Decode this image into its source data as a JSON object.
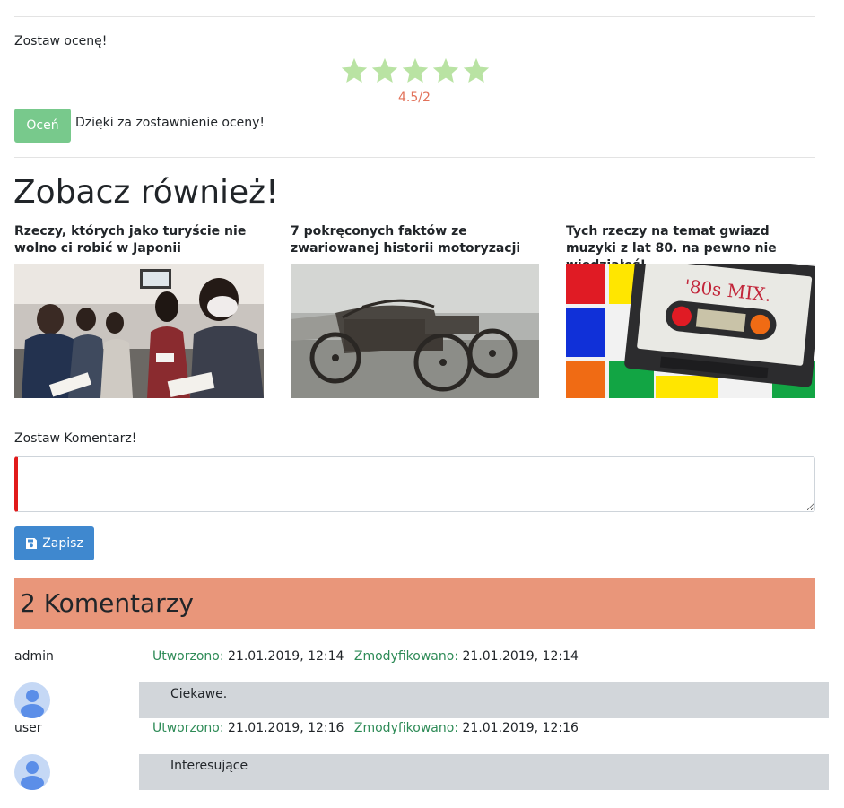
{
  "rating": {
    "label": "Zostaw ocenę!",
    "value": "4.5/2",
    "stars_total": 5,
    "star_color": "#b9e3a3",
    "button_label": "Oceń",
    "thanks": "Dzięki za zostawnienie oceny!"
  },
  "see_also": {
    "title": "Zobacz również!",
    "articles": [
      {
        "title": "Rzeczy, których jako turyście nie wolno ci robić w Japonii",
        "image": "people-seated-photo"
      },
      {
        "title": "7 pokręconych faktów ze zwariowanej historii motoryzacji",
        "image": "vintage-car-photo"
      },
      {
        "title": "Tych rzeczy na temat gwiazd muzyki z lat 80. na pewno nie wiedziałeś!",
        "image": "cassette-tape-photo",
        "cassette_label": "'80s MIX."
      }
    ]
  },
  "comment_form": {
    "label": "Zostaw Komentarz!",
    "textarea_value": "",
    "save_label": "Zapisz",
    "save_icon": "floppy-disk-icon"
  },
  "comments": {
    "header": "2 Komentarzy",
    "created_label": "Utworzono:",
    "modified_label": "Zmodyfikowano:",
    "items": [
      {
        "author": "admin",
        "created": "21.01.2019, 12:14",
        "modified": "21.01.2019, 12:14",
        "text": "Ciekawe."
      },
      {
        "author": "user",
        "created": "21.01.2019, 12:16",
        "modified": "21.01.2019, 12:16",
        "text": "Interesujące"
      }
    ]
  },
  "colors": {
    "rate_button": "#78c98c",
    "save_button": "#3f88cf",
    "comments_header": "#e9967a",
    "meta_label": "#2e8b57",
    "rating_value": "#e2725a",
    "comment_body": "#d2d6da"
  }
}
